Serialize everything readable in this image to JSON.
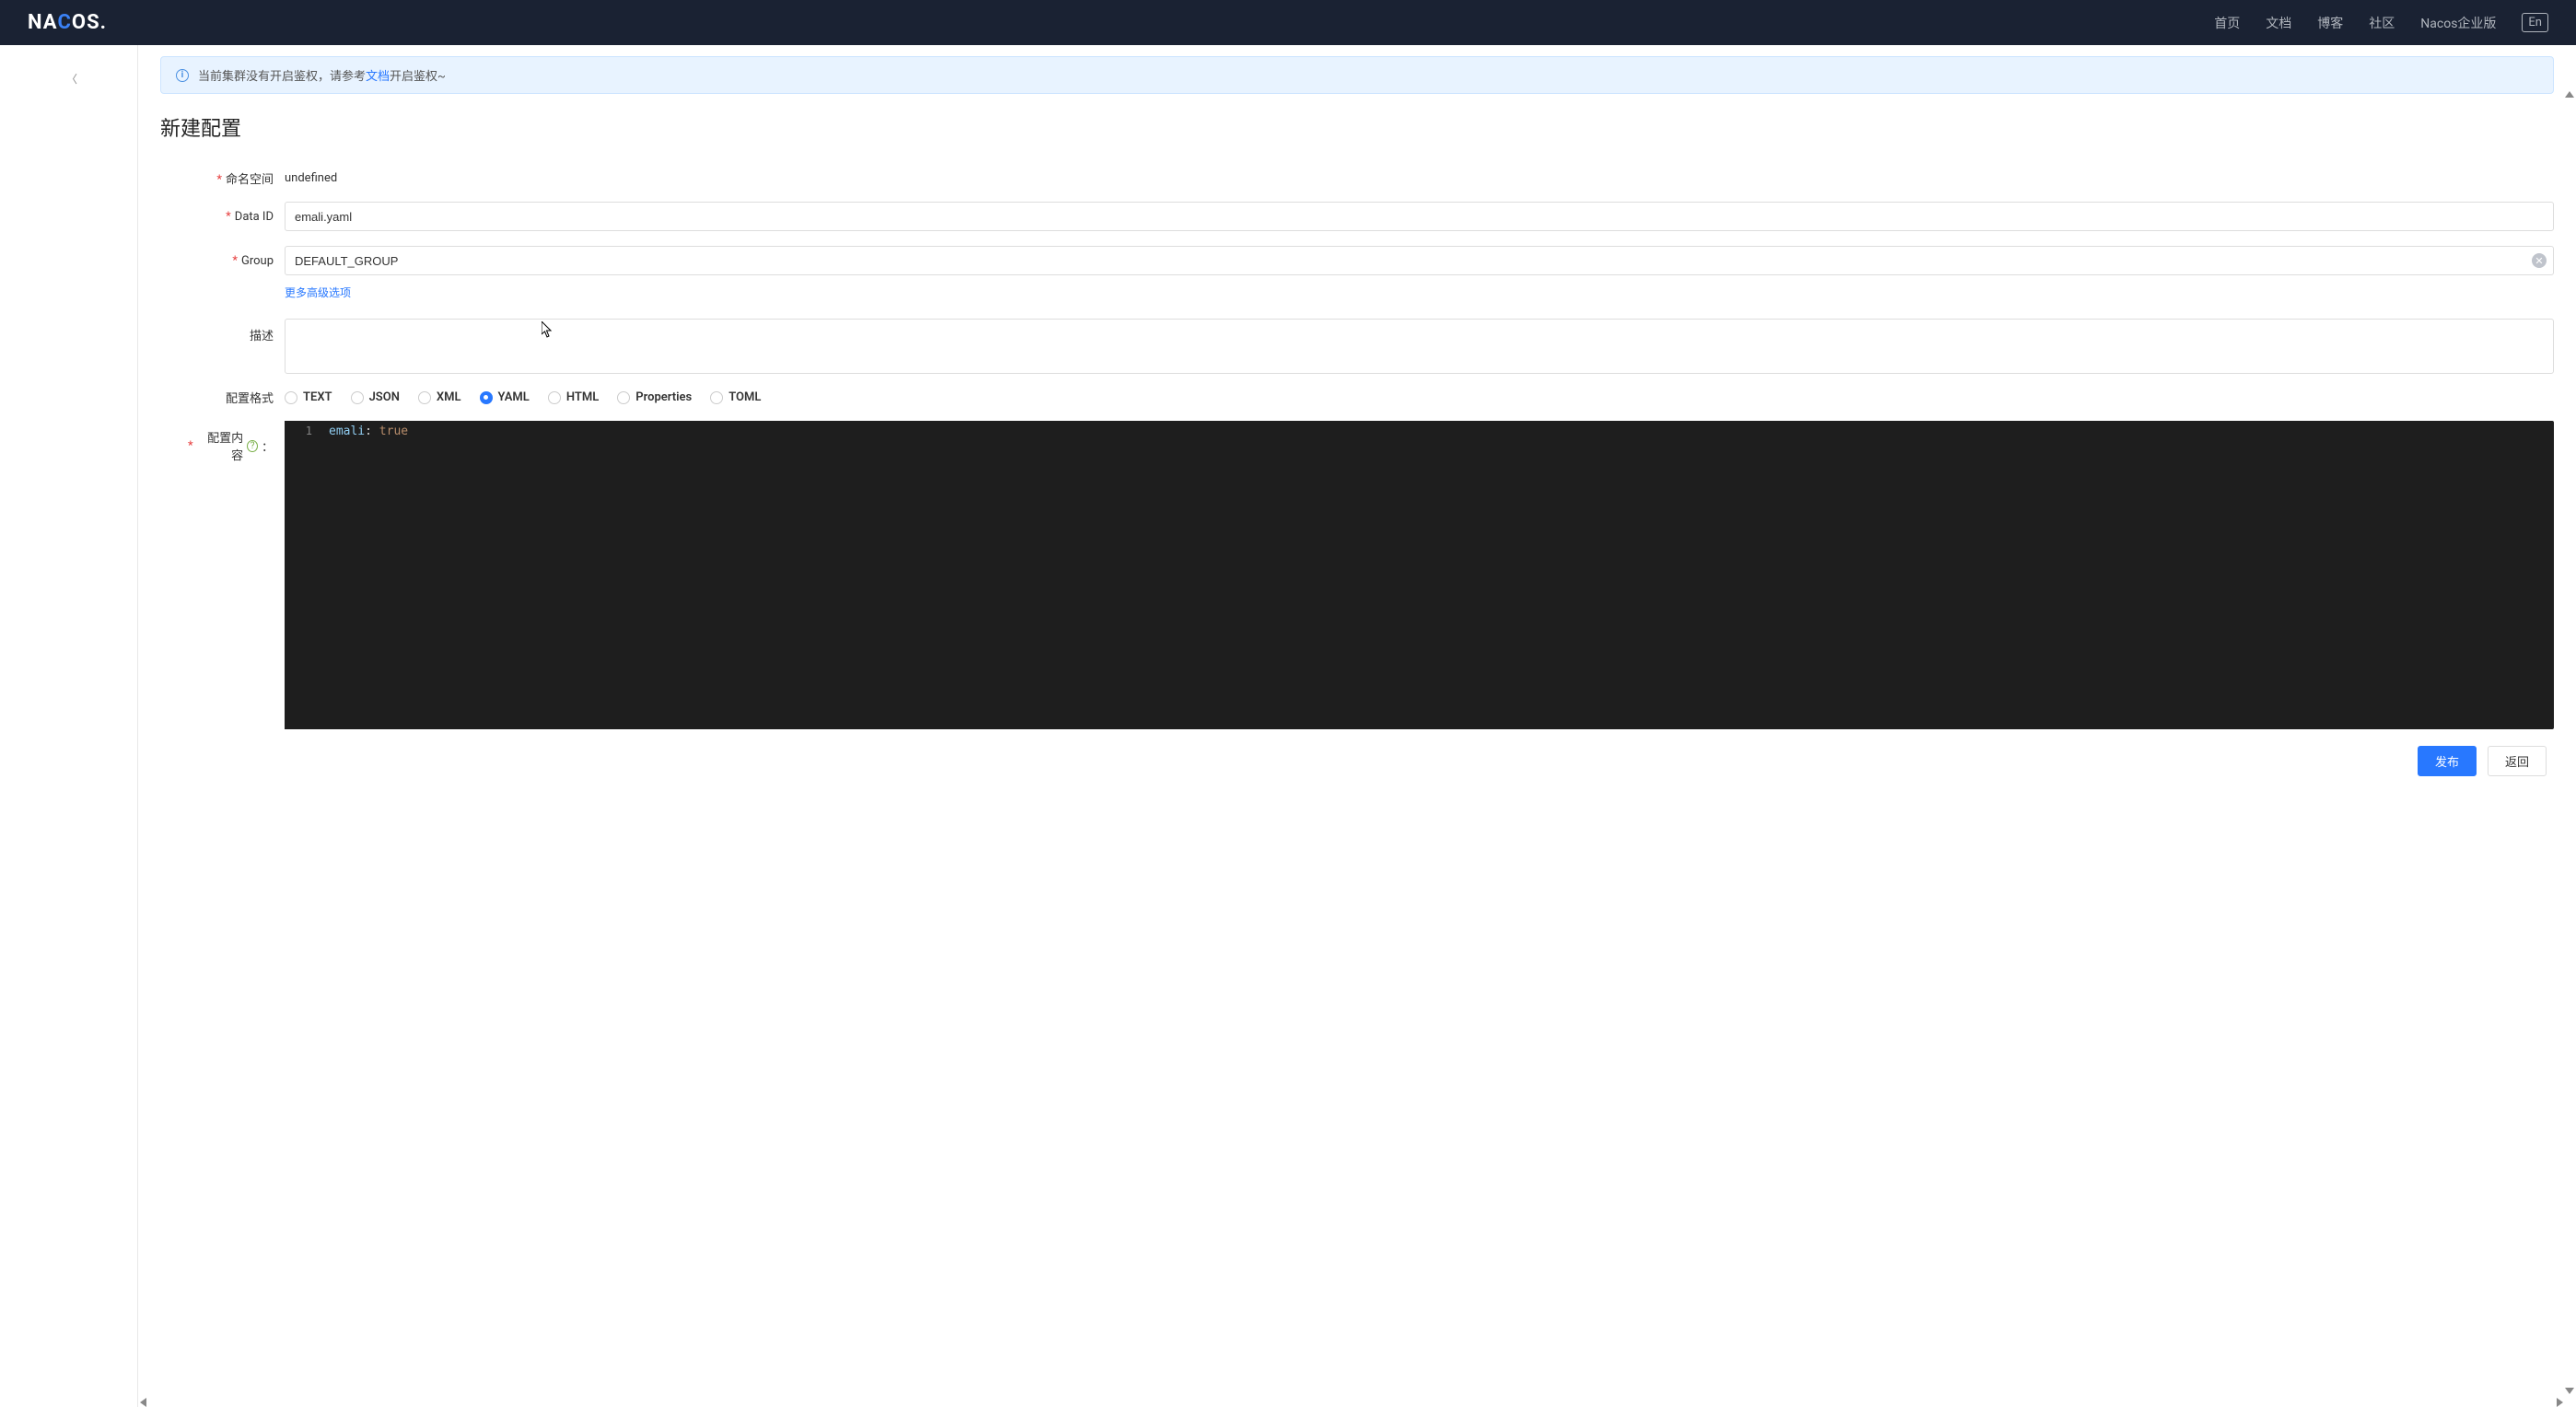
{
  "header": {
    "logo": "NACOS.",
    "nav": [
      "首页",
      "文档",
      "博客",
      "社区",
      "Nacos企业版"
    ],
    "lang": "En"
  },
  "alert": {
    "text_before": "当前集群没有开启鉴权，请参考",
    "link": "文档",
    "text_after": "开启鉴权~"
  },
  "page_title": "新建配置",
  "form": {
    "namespace": {
      "label": "命名空间",
      "value": "undefined"
    },
    "data_id": {
      "label": "Data ID",
      "value": "emali.yaml"
    },
    "group": {
      "label": "Group",
      "value": "DEFAULT_GROUP"
    },
    "advanced": "更多高级选项",
    "description": {
      "label": "描述",
      "value": ""
    },
    "format": {
      "label": "配置格式",
      "options": [
        "TEXT",
        "JSON",
        "XML",
        "YAML",
        "HTML",
        "Properties",
        "TOML"
      ],
      "selected": "YAML"
    },
    "content": {
      "label": "配置内容",
      "colon": "：",
      "code_key": "emali",
      "code_val": "true"
    }
  },
  "footer": {
    "publish": "发布",
    "back": "返回"
  }
}
